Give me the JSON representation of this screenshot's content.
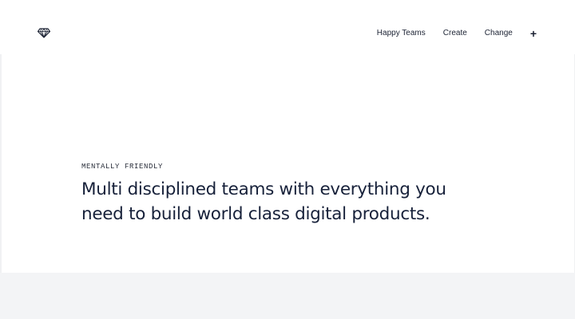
{
  "header": {
    "logo_icon": "diamond-icon",
    "nav": [
      {
        "label": "Happy Teams"
      },
      {
        "label": "Create"
      },
      {
        "label": "Change"
      }
    ],
    "plus_label": "+"
  },
  "hero": {
    "eyebrow": "MENTALLY FRIENDLY",
    "headline": "Multi disciplined teams with everything you need to build world class digital products."
  },
  "colors": {
    "text": "#17213a",
    "background": "#ffffff",
    "footer_band": "#f3f4f6"
  }
}
